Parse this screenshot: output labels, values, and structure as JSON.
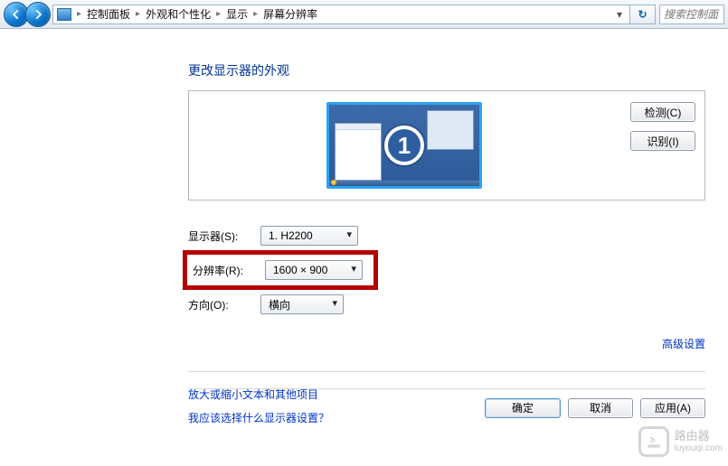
{
  "toolbar": {
    "breadcrumbs": [
      "控制面板",
      "外观和个性化",
      "显示",
      "屏幕分辨率"
    ],
    "search_placeholder": "搜索控制面"
  },
  "heading": "更改显示器的外观",
  "monitor": {
    "number": "1",
    "detect_label": "检测(C)",
    "identify_label": "识别(I)"
  },
  "fields": {
    "display": {
      "label": "显示器(S):",
      "value": "1. H2200"
    },
    "resolution": {
      "label": "分辨率(R):",
      "value": "1600 × 900"
    },
    "orientation": {
      "label": "方向(O):",
      "value": "横向"
    }
  },
  "advanced_link": "高级设置",
  "links": {
    "text_size": "放大或缩小文本和其他项目",
    "what_settings": "我应该选择什么显示器设置？"
  },
  "buttons": {
    "ok": "确定",
    "cancel": "取消",
    "apply": "应用(A)"
  },
  "watermark": {
    "title": "路由器",
    "sub": "luyouqi.com"
  }
}
